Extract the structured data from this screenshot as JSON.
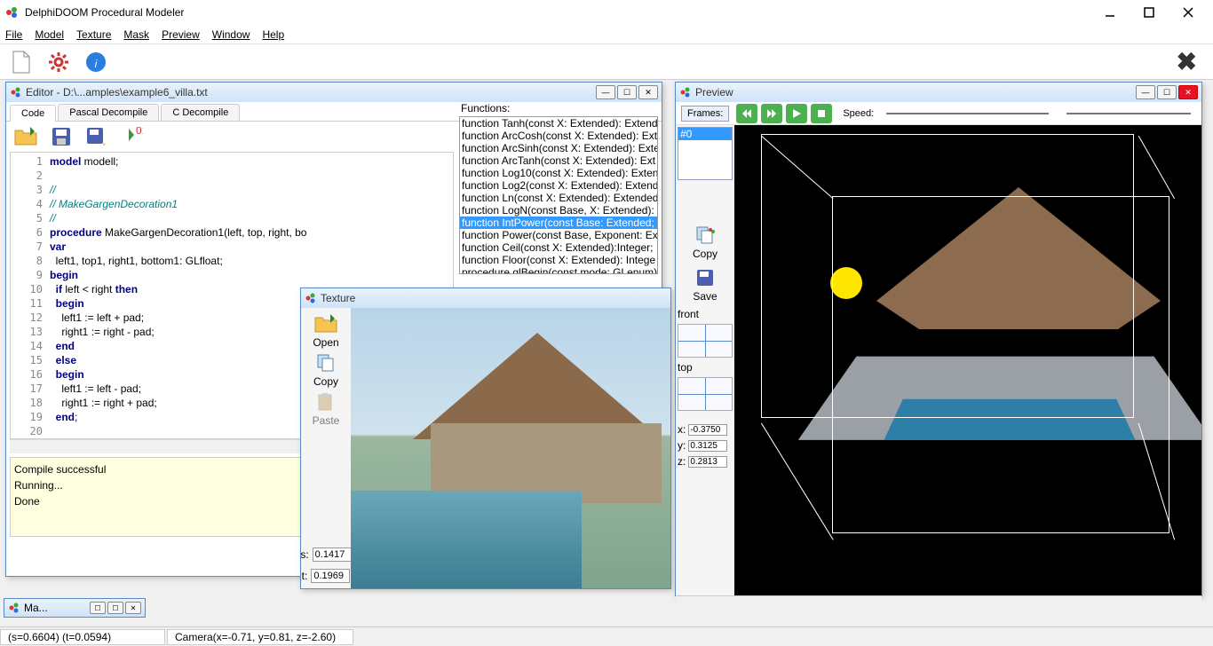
{
  "app": {
    "title": "DelphiDOOM Procedural Modeler"
  },
  "menu": [
    "File",
    "Model",
    "Texture",
    "Mask",
    "Preview",
    "Window",
    "Help"
  ],
  "editor": {
    "title": "Editor - D:\\...amples\\example6_villa.txt",
    "tabs": [
      "Code",
      "Pascal Decompile",
      "C Decompile"
    ],
    "active_tab": 0,
    "functions_label": "Functions:",
    "functions": [
      "function Tanh(const X: Extended): Extend",
      "function ArcCosh(const X: Extended): Ext",
      "function ArcSinh(const X: Extended): Exte",
      "function ArcTanh(const X: Extended): Ext",
      "function Log10(const X: Extended): Exten",
      "function Log2(const X: Extended): Extend",
      "function Ln(const X: Extended): Extended",
      "function LogN(const Base, X: Extended): E",
      "function IntPower(const Base: Extended;",
      "function Power(const Base, Exponent: Ex",
      "function Ceil(const X: Extended):Integer;",
      "function Floor(const X: Extended): Intege",
      "procedure glBegin(const mode: GLenum): "
    ],
    "functions_selected": 8,
    "code": [
      {
        "n": 1,
        "t": "kw",
        "s": "model modell;"
      },
      {
        "n": 2,
        "t": "",
        "s": ""
      },
      {
        "n": 3,
        "t": "cm",
        "s": "//"
      },
      {
        "n": 4,
        "t": "cm",
        "s": "// MakeGargenDecoration1"
      },
      {
        "n": 5,
        "t": "cm",
        "s": "//"
      },
      {
        "n": 6,
        "t": "kw",
        "s": "procedure MakeGargenDecoration1(left, top, right, bo"
      },
      {
        "n": 7,
        "t": "kw",
        "s": "var"
      },
      {
        "n": 8,
        "t": "",
        "s": "  left1, top1, right1, bottom1: GLfloat;"
      },
      {
        "n": 9,
        "t": "kw",
        "s": "begin"
      },
      {
        "n": 10,
        "t": "",
        "s": "  if left < right then"
      },
      {
        "n": 11,
        "t": "kw",
        "s": "  begin"
      },
      {
        "n": 12,
        "t": "",
        "s": "    left1 := left + pad;"
      },
      {
        "n": 13,
        "t": "",
        "s": "    right1 := right - pad;"
      },
      {
        "n": 14,
        "t": "kw",
        "s": "  end"
      },
      {
        "n": 15,
        "t": "kw",
        "s": "  else"
      },
      {
        "n": 16,
        "t": "kw",
        "s": "  begin"
      },
      {
        "n": 17,
        "t": "",
        "s": "    left1 := left - pad;"
      },
      {
        "n": 18,
        "t": "",
        "s": "    right1 := right + pad;"
      },
      {
        "n": 19,
        "t": "kw",
        "s": "  end;"
      },
      {
        "n": 20,
        "t": "",
        "s": ""
      }
    ],
    "console": [
      "Compile successful",
      "",
      "Running...",
      "",
      "Done"
    ]
  },
  "texture": {
    "title": "Texture",
    "open": "Open",
    "copy": "Copy",
    "paste": "Paste",
    "s_label": "s:",
    "t_label": "t:",
    "s": "0.1417",
    "t": "0.1969"
  },
  "preview": {
    "title": "Preview",
    "frames_label": "Frames:",
    "frame0": "#0",
    "speed_label": "Speed:",
    "copy": "Copy",
    "save": "Save",
    "front": "front",
    "top": "top",
    "x_label": "x:",
    "y_label": "y:",
    "z_label": "z:",
    "x": "-0.3750",
    "y": "0.3125",
    "z": "0.2813"
  },
  "minimized": {
    "label": "Ma..."
  },
  "status": {
    "st": "(s=0.6604) (t=0.0594)",
    "cam": "Camera(x=-0.71, y=0.81, z=-2.60)"
  }
}
